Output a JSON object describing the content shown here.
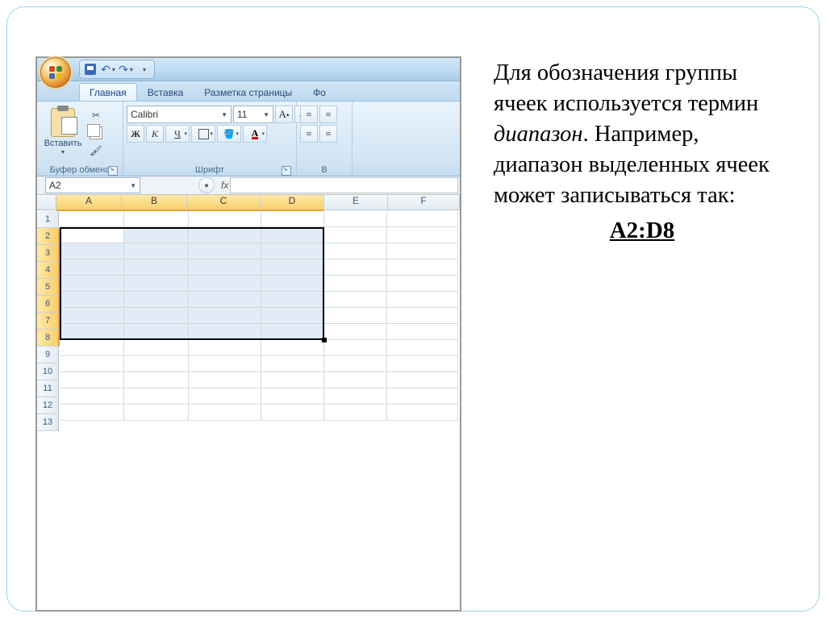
{
  "excel": {
    "tabs": [
      "Главная",
      "Вставка",
      "Разметка страницы",
      "Фо"
    ],
    "active_tab": "Главная",
    "clipboard": {
      "paste": "Вставить",
      "group_label": "Буфер обмена"
    },
    "font": {
      "name": "Calibri",
      "size": "11",
      "bold": "Ж",
      "italic": "К",
      "underline": "Ч",
      "grow": "A",
      "shrink": "A",
      "group_label": "Шрифт"
    },
    "align": {
      "group_label": "В"
    },
    "namebox": "A2",
    "fx_label": "fx",
    "columns": [
      "A",
      "B",
      "C",
      "D",
      "E",
      "F"
    ],
    "selected_cols": [
      "A",
      "B",
      "C",
      "D"
    ],
    "rows": [
      "1",
      "2",
      "3",
      "4",
      "5",
      "6",
      "7",
      "8",
      "9",
      "10",
      "11",
      "12",
      "13"
    ],
    "selected_rows": [
      "2",
      "3",
      "4",
      "5",
      "6",
      "7",
      "8"
    ],
    "active_cell": "A2",
    "selection": "A2:D8"
  },
  "slide": {
    "p1a": "Для обозначения группы ячеек используется термин ",
    "p1b": "диапазон",
    "p1c": ". Например, диапазон выделенных ячеек может записываться так:",
    "range": "A2:D8"
  }
}
